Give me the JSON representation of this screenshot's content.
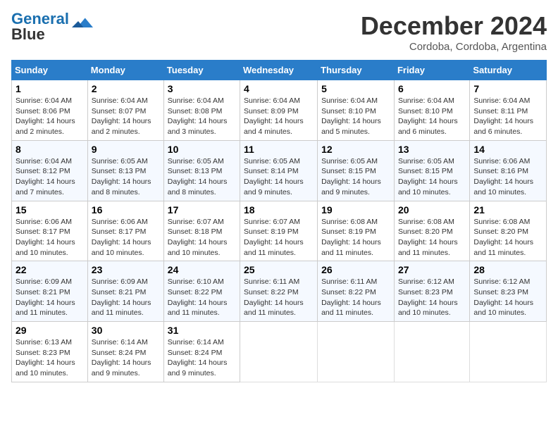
{
  "header": {
    "logo_line1": "General",
    "logo_line2": "Blue",
    "month_title": "December 2024",
    "subtitle": "Cordoba, Cordoba, Argentina"
  },
  "weekdays": [
    "Sunday",
    "Monday",
    "Tuesday",
    "Wednesday",
    "Thursday",
    "Friday",
    "Saturday"
  ],
  "weeks": [
    [
      {
        "day": "1",
        "sunrise": "Sunrise: 6:04 AM",
        "sunset": "Sunset: 8:06 PM",
        "daylight": "Daylight: 14 hours and 2 minutes."
      },
      {
        "day": "2",
        "sunrise": "Sunrise: 6:04 AM",
        "sunset": "Sunset: 8:07 PM",
        "daylight": "Daylight: 14 hours and 2 minutes."
      },
      {
        "day": "3",
        "sunrise": "Sunrise: 6:04 AM",
        "sunset": "Sunset: 8:08 PM",
        "daylight": "Daylight: 14 hours and 3 minutes."
      },
      {
        "day": "4",
        "sunrise": "Sunrise: 6:04 AM",
        "sunset": "Sunset: 8:09 PM",
        "daylight": "Daylight: 14 hours and 4 minutes."
      },
      {
        "day": "5",
        "sunrise": "Sunrise: 6:04 AM",
        "sunset": "Sunset: 8:10 PM",
        "daylight": "Daylight: 14 hours and 5 minutes."
      },
      {
        "day": "6",
        "sunrise": "Sunrise: 6:04 AM",
        "sunset": "Sunset: 8:10 PM",
        "daylight": "Daylight: 14 hours and 6 minutes."
      },
      {
        "day": "7",
        "sunrise": "Sunrise: 6:04 AM",
        "sunset": "Sunset: 8:11 PM",
        "daylight": "Daylight: 14 hours and 6 minutes."
      }
    ],
    [
      {
        "day": "8",
        "sunrise": "Sunrise: 6:04 AM",
        "sunset": "Sunset: 8:12 PM",
        "daylight": "Daylight: 14 hours and 7 minutes."
      },
      {
        "day": "9",
        "sunrise": "Sunrise: 6:05 AM",
        "sunset": "Sunset: 8:13 PM",
        "daylight": "Daylight: 14 hours and 8 minutes."
      },
      {
        "day": "10",
        "sunrise": "Sunrise: 6:05 AM",
        "sunset": "Sunset: 8:13 PM",
        "daylight": "Daylight: 14 hours and 8 minutes."
      },
      {
        "day": "11",
        "sunrise": "Sunrise: 6:05 AM",
        "sunset": "Sunset: 8:14 PM",
        "daylight": "Daylight: 14 hours and 9 minutes."
      },
      {
        "day": "12",
        "sunrise": "Sunrise: 6:05 AM",
        "sunset": "Sunset: 8:15 PM",
        "daylight": "Daylight: 14 hours and 9 minutes."
      },
      {
        "day": "13",
        "sunrise": "Sunrise: 6:05 AM",
        "sunset": "Sunset: 8:15 PM",
        "daylight": "Daylight: 14 hours and 10 minutes."
      },
      {
        "day": "14",
        "sunrise": "Sunrise: 6:06 AM",
        "sunset": "Sunset: 8:16 PM",
        "daylight": "Daylight: 14 hours and 10 minutes."
      }
    ],
    [
      {
        "day": "15",
        "sunrise": "Sunrise: 6:06 AM",
        "sunset": "Sunset: 8:17 PM",
        "daylight": "Daylight: 14 hours and 10 minutes."
      },
      {
        "day": "16",
        "sunrise": "Sunrise: 6:06 AM",
        "sunset": "Sunset: 8:17 PM",
        "daylight": "Daylight: 14 hours and 10 minutes."
      },
      {
        "day": "17",
        "sunrise": "Sunrise: 6:07 AM",
        "sunset": "Sunset: 8:18 PM",
        "daylight": "Daylight: 14 hours and 10 minutes."
      },
      {
        "day": "18",
        "sunrise": "Sunrise: 6:07 AM",
        "sunset": "Sunset: 8:19 PM",
        "daylight": "Daylight: 14 hours and 11 minutes."
      },
      {
        "day": "19",
        "sunrise": "Sunrise: 6:08 AM",
        "sunset": "Sunset: 8:19 PM",
        "daylight": "Daylight: 14 hours and 11 minutes."
      },
      {
        "day": "20",
        "sunrise": "Sunrise: 6:08 AM",
        "sunset": "Sunset: 8:20 PM",
        "daylight": "Daylight: 14 hours and 11 minutes."
      },
      {
        "day": "21",
        "sunrise": "Sunrise: 6:08 AM",
        "sunset": "Sunset: 8:20 PM",
        "daylight": "Daylight: 14 hours and 11 minutes."
      }
    ],
    [
      {
        "day": "22",
        "sunrise": "Sunrise: 6:09 AM",
        "sunset": "Sunset: 8:21 PM",
        "daylight": "Daylight: 14 hours and 11 minutes."
      },
      {
        "day": "23",
        "sunrise": "Sunrise: 6:09 AM",
        "sunset": "Sunset: 8:21 PM",
        "daylight": "Daylight: 14 hours and 11 minutes."
      },
      {
        "day": "24",
        "sunrise": "Sunrise: 6:10 AM",
        "sunset": "Sunset: 8:22 PM",
        "daylight": "Daylight: 14 hours and 11 minutes."
      },
      {
        "day": "25",
        "sunrise": "Sunrise: 6:11 AM",
        "sunset": "Sunset: 8:22 PM",
        "daylight": "Daylight: 14 hours and 11 minutes."
      },
      {
        "day": "26",
        "sunrise": "Sunrise: 6:11 AM",
        "sunset": "Sunset: 8:22 PM",
        "daylight": "Daylight: 14 hours and 11 minutes."
      },
      {
        "day": "27",
        "sunrise": "Sunrise: 6:12 AM",
        "sunset": "Sunset: 8:23 PM",
        "daylight": "Daylight: 14 hours and 10 minutes."
      },
      {
        "day": "28",
        "sunrise": "Sunrise: 6:12 AM",
        "sunset": "Sunset: 8:23 PM",
        "daylight": "Daylight: 14 hours and 10 minutes."
      }
    ],
    [
      {
        "day": "29",
        "sunrise": "Sunrise: 6:13 AM",
        "sunset": "Sunset: 8:23 PM",
        "daylight": "Daylight: 14 hours and 10 minutes."
      },
      {
        "day": "30",
        "sunrise": "Sunrise: 6:14 AM",
        "sunset": "Sunset: 8:24 PM",
        "daylight": "Daylight: 14 hours and 9 minutes."
      },
      {
        "day": "31",
        "sunrise": "Sunrise: 6:14 AM",
        "sunset": "Sunset: 8:24 PM",
        "daylight": "Daylight: 14 hours and 9 minutes."
      },
      null,
      null,
      null,
      null
    ]
  ]
}
